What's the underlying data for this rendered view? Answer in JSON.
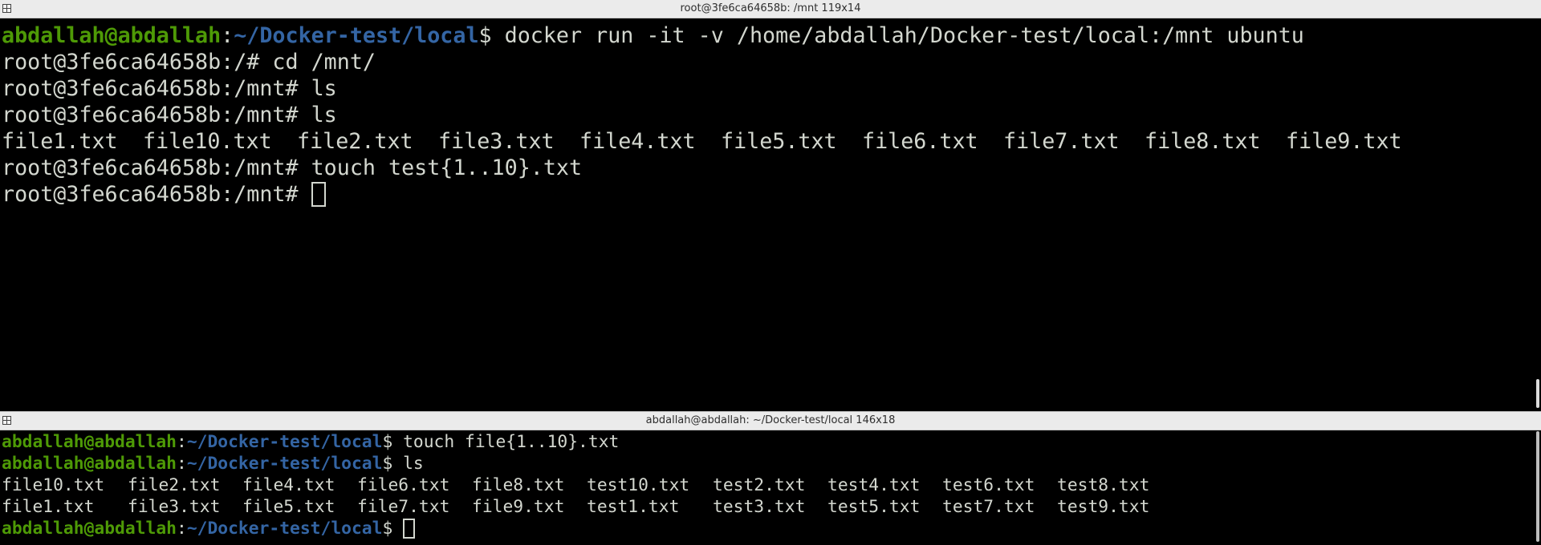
{
  "top_window": {
    "title": "root@3fe6ca64658b: /mnt 119x14",
    "lines": [
      {
        "user": "abdallah@abdallah",
        "sep": ":",
        "path": "~/Docker-test/local",
        "dollar": "$",
        "cmd": " docker run -it -v /home/abdallah/Docker-test/local:/mnt ubuntu"
      },
      {
        "text": "root@3fe6ca64658b:/# cd /mnt/"
      },
      {
        "text": "root@3fe6ca64658b:/mnt# ls"
      },
      {
        "text": "root@3fe6ca64658b:/mnt# ls"
      },
      {
        "text": "root@3fe6ca64658b:/mnt# touch test{1..10}.txt"
      },
      {
        "text": "root@3fe6ca64658b:/mnt# "
      }
    ],
    "ls_output": [
      "file1.txt",
      "file10.txt",
      "file2.txt",
      "file3.txt",
      "file4.txt",
      "file5.txt",
      "file6.txt",
      "file7.txt",
      "file8.txt",
      "file9.txt"
    ]
  },
  "bottom_window": {
    "title": "abdallah@abdallah: ~/Docker-test/local 146x18",
    "prompt": {
      "user": "abdallah@abdallah",
      "sep": ":",
      "path": "~/Docker-test/local",
      "dollar": "$"
    },
    "cmd1": " touch file{1..10}.txt",
    "cmd2": " ls",
    "cmd3": " ",
    "ls_row1": [
      "file10.txt",
      "file2.txt",
      "file4.txt",
      "file6.txt",
      "file8.txt",
      "test10.txt",
      "test2.txt",
      "test4.txt",
      "test6.txt",
      "test8.txt"
    ],
    "ls_row2": [
      "file1.txt",
      "file3.txt",
      "file5.txt",
      "file7.txt",
      "file9.txt",
      "test1.txt",
      "test3.txt",
      "test5.txt",
      "test7.txt",
      "test9.txt"
    ]
  },
  "colors": {
    "prompt_user": "#4e9a06",
    "prompt_path": "#3465a4",
    "text": "#d3d7cf",
    "background": "#000000",
    "titlebar": "#ebebeb"
  }
}
